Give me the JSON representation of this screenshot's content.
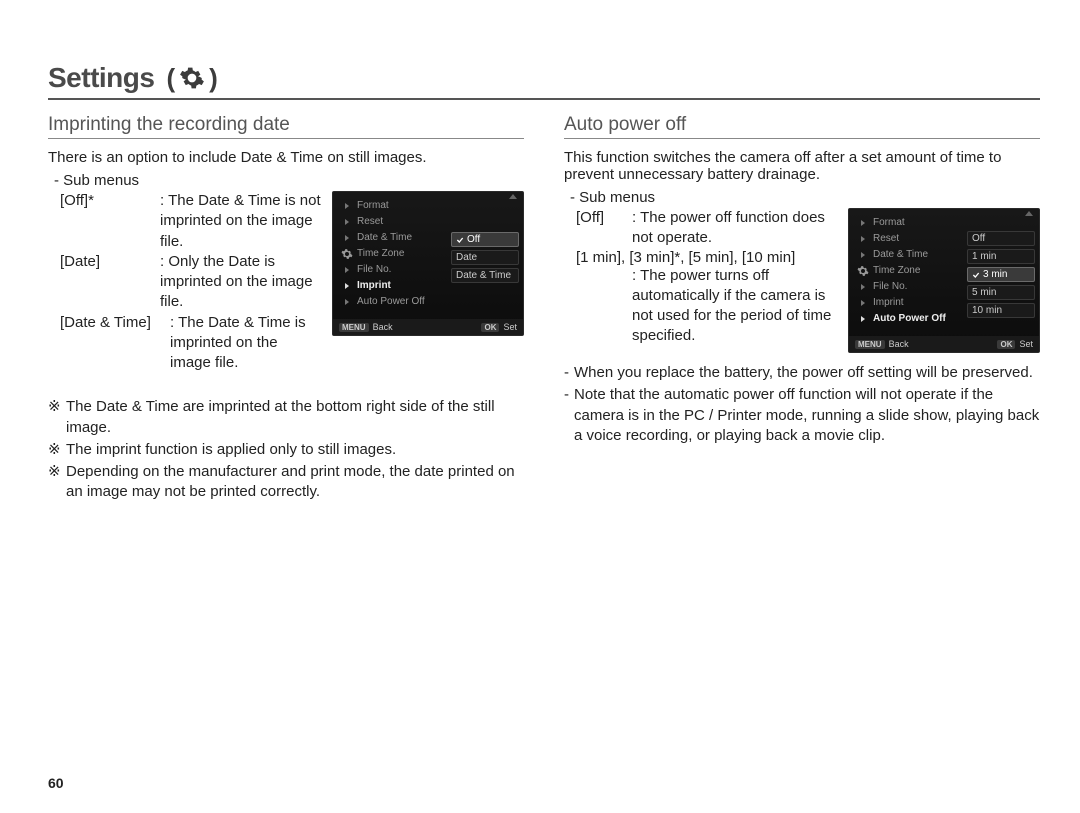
{
  "page_number": "60",
  "title": "Settings",
  "left": {
    "heading": "Imprinting the recording date",
    "intro": "There is an option to include Date & Time on still images.",
    "submenus_label": "- Sub menus",
    "items": [
      {
        "key": "[Off]*",
        "desc": "The Date & Time is not imprinted on the image file."
      },
      {
        "key": "[Date]",
        "desc": "Only the Date is imprinted on the image file."
      },
      {
        "key": "[Date & Time]",
        "desc": "The Date & Time is imprinted on the image file."
      }
    ],
    "notes": [
      "The Date & Time are imprinted at the bottom right side of the still image.",
      "The imprint function is applied only to still images.",
      "Depending on the manufacturer and print mode, the date printed on an image may not be printed correctly."
    ],
    "note_mark": "※",
    "lcd": {
      "menu": [
        "Format",
        "Reset",
        "Date & Time",
        "Time Zone",
        "File No.",
        "Imprint",
        "Auto Power Off"
      ],
      "highlight_index": 5,
      "options": [
        "Off",
        "Date",
        "Date & Time"
      ],
      "selected_option_index": 0,
      "footer_left_tag": "MENU",
      "footer_left": "Back",
      "footer_right_tag": "OK",
      "footer_right": "Set"
    }
  },
  "right": {
    "heading": "Auto power off",
    "intro": "This function switches the camera off after a set amount of time to prevent unnecessary battery drainage.",
    "submenus_label": "- Sub menus",
    "off_key": "[Off]",
    "off_desc": "The power off function does not operate.",
    "options_line": "[1 min], [3 min]*, [5 min], [10 min]",
    "options_desc": "The power turns off automatically if the camera is not used for the period of time specified.",
    "notes": [
      "When you replace the battery, the power off setting will be preserved.",
      "Note that the automatic power off function will not operate if the camera is in the PC / Printer mode, running a slide show, playing back a voice recording, or playing back a movie clip."
    ],
    "lcd": {
      "menu": [
        "Format",
        "Reset",
        "Date & Time",
        "Time Zone",
        "File No.",
        "Imprint",
        "Auto Power Off"
      ],
      "highlight_index": 6,
      "options": [
        "Off",
        "1 min",
        "3 min",
        "5 min",
        "10 min"
      ],
      "selected_option_index": 2,
      "footer_left_tag": "MENU",
      "footer_left": "Back",
      "footer_right_tag": "OK",
      "footer_right": "Set"
    }
  }
}
